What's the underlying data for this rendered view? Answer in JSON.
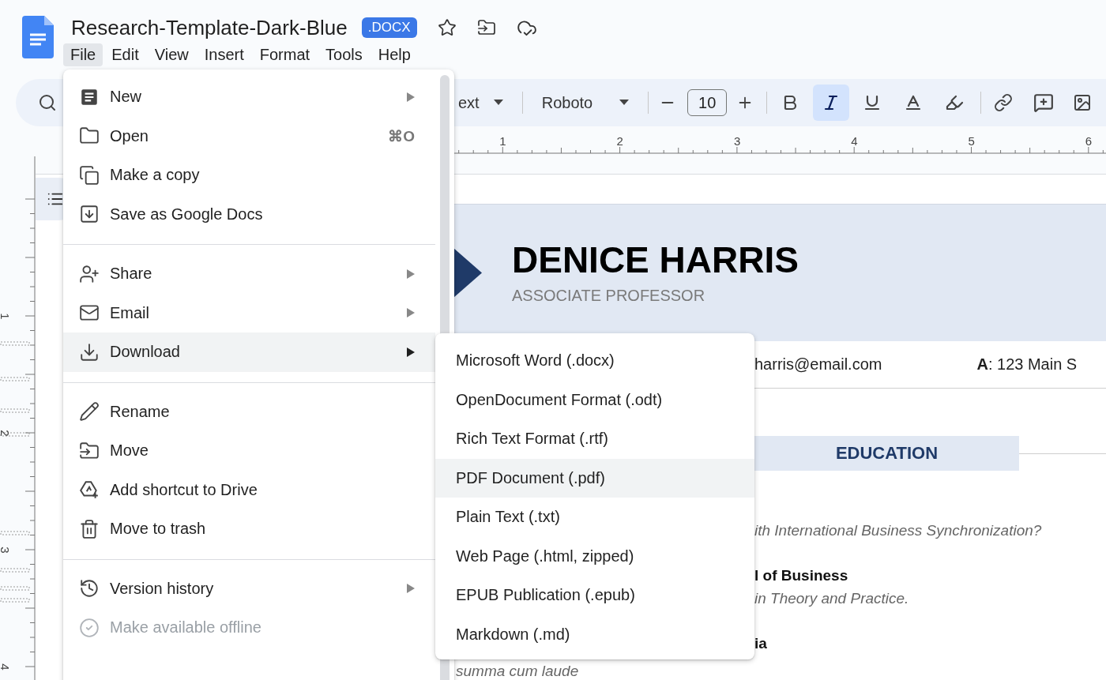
{
  "document_header": {
    "title": "Research-Template-Dark-Blue",
    "badge": ".DOCX"
  },
  "menu_bar": [
    {
      "label": "File",
      "selected": true
    },
    {
      "label": "Edit",
      "selected": false
    },
    {
      "label": "View",
      "selected": false
    },
    {
      "label": "Insert",
      "selected": false
    },
    {
      "label": "Format",
      "selected": false
    },
    {
      "label": "Tools",
      "selected": false
    },
    {
      "label": "Help",
      "selected": false
    }
  ],
  "toolbar": {
    "style_name": "ext",
    "font_name": "Roboto",
    "font_size": "10",
    "formats": [
      {
        "kind": "bold",
        "selected": false
      },
      {
        "kind": "italic",
        "selected": true
      },
      {
        "kind": "underline",
        "selected": false
      },
      {
        "kind": "text_color",
        "selected": false
      },
      {
        "kind": "highlight",
        "selected": false
      }
    ]
  },
  "rulers": {
    "horizontal": [
      "1",
      "2",
      "3",
      "4",
      "5",
      "6"
    ],
    "vertical": [
      "1",
      "2",
      "3",
      "4"
    ]
  },
  "file_menu": {
    "sections": [
      {
        "items": [
          {
            "label": "New",
            "has_submenu": true,
            "selected": false,
            "disabled": false
          },
          {
            "label": "Open",
            "shortcut": "⌘O",
            "has_submenu": false,
            "selected": false,
            "disabled": false
          },
          {
            "label": "Make a copy",
            "has_submenu": false,
            "selected": false,
            "disabled": false
          },
          {
            "label": "Save as Google Docs",
            "has_submenu": false,
            "selected": false,
            "disabled": false
          }
        ]
      },
      {
        "items": [
          {
            "label": "Share",
            "has_submenu": true,
            "selected": false,
            "disabled": false
          },
          {
            "label": "Email",
            "has_submenu": true,
            "selected": false,
            "disabled": false
          },
          {
            "label": "Download",
            "has_submenu": true,
            "selected": true,
            "disabled": false
          }
        ]
      },
      {
        "items": [
          {
            "label": "Rename",
            "has_submenu": false,
            "selected": false,
            "disabled": false
          },
          {
            "label": "Move",
            "has_submenu": false,
            "selected": false,
            "disabled": false
          },
          {
            "label": "Add shortcut to Drive",
            "has_submenu": false,
            "selected": false,
            "disabled": false
          },
          {
            "label": "Move to trash",
            "has_submenu": false,
            "selected": false,
            "disabled": false
          }
        ]
      },
      {
        "items": [
          {
            "label": "Version history",
            "has_submenu": true,
            "selected": false,
            "disabled": false
          },
          {
            "label": "Make available offline",
            "has_submenu": false,
            "selected": false,
            "disabled": true
          }
        ]
      }
    ]
  },
  "download_menu": {
    "items": [
      {
        "label": "Microsoft Word (.docx)",
        "selected": false
      },
      {
        "label": "OpenDocument Format (.odt)",
        "selected": false
      },
      {
        "label": "Rich Text Format (.rtf)",
        "selected": false
      },
      {
        "label": "PDF Document (.pdf)",
        "selected": true
      },
      {
        "label": "Plain Text (.txt)",
        "selected": false
      },
      {
        "label": "Web Page (.html, zipped)",
        "selected": false
      },
      {
        "label": "EPUB Publication (.epub)",
        "selected": false
      },
      {
        "label": "Markdown (.md)",
        "selected": false
      }
    ]
  },
  "document": {
    "name": "DENICE HARRIS",
    "role": "ASSOCIATE PROFESSOR",
    "email": "harris@email.com",
    "address": "**A**: 123 Main S",
    "section_heading": "EDUCATION",
    "lines": [
      {
        "kind": "italic",
        "text": "ith International Business Synchronization?"
      },
      {
        "kind": "bold",
        "text": "l of Business"
      },
      {
        "kind": "italic",
        "text": "in Theory and Practice."
      },
      {
        "kind": "bold",
        "text": "ia"
      }
    ],
    "honors": "summa cum laude"
  }
}
